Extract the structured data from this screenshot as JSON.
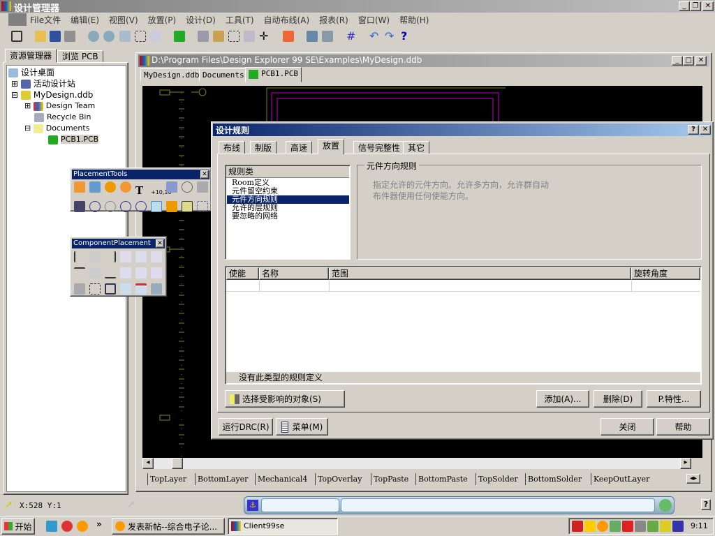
{
  "app": {
    "title": "设计管理器"
  },
  "menu": [
    "File文件",
    "编辑(E)",
    "视图(V)",
    "放置(P)",
    "设计(D)",
    "工具(T)",
    "自动布线(A)",
    "报表(R)",
    "窗口(W)",
    "帮助(H)"
  ],
  "left_tabs": [
    "资源管理器",
    "浏览 PCB"
  ],
  "tree": [
    {
      "label": "设计桌面",
      "icon": "desktop-icon"
    },
    {
      "label": "活动设计站",
      "icon": "workstation-icon"
    },
    {
      "label": "MyDesign.ddb",
      "icon": "database-icon"
    },
    {
      "label": "Design Team",
      "icon": "team-icon"
    },
    {
      "label": "Recycle Bin",
      "icon": "recycle-bin-icon"
    },
    {
      "label": "Documents",
      "icon": "folder-icon"
    },
    {
      "label": "PCB1.PCB",
      "icon": "pcb-file-icon"
    }
  ],
  "doc_window": {
    "title": "D:\\Program Files\\Design Explorer 99 SE\\Examples\\MyDesign.ddb",
    "tabs": [
      "MyDesign.ddb",
      "Documents",
      "PCB1.PCB"
    ]
  },
  "layers": [
    "TopLayer",
    "BottomLayer",
    "Mechanical4",
    "TopOverlay",
    "TopPaste",
    "BottomPaste",
    "TopSolder",
    "BottomSolder",
    "KeepOutLayer"
  ],
  "placement_tools": {
    "title": "PlacementTools"
  },
  "component_placement": {
    "title": "ComponentPlacement"
  },
  "dialog": {
    "title": "设计规则",
    "tabs": [
      "布线",
      "制版",
      "高速",
      "放置",
      "信号完整性",
      "其它"
    ],
    "active_tab": "放置",
    "rule_class_header": "规则类",
    "rule_classes": [
      "Room定义",
      "元件留空约束",
      "元件方向规则",
      "允许的层规则",
      "要忽略的网络"
    ],
    "selected_rule": "元件方向规则",
    "group_title": "元件方向规则",
    "description_line1": "指定允许的元件方向。允许多方向，允许群自动",
    "description_line2": "布件器使用任何使能方向。",
    "columns": [
      "使能",
      "名称",
      "范围",
      "旋转角度"
    ],
    "footer": "没有此类型的规则定义",
    "select_objects": "选择受影响的对象(S)",
    "add": "添加(A)...",
    "delete": "删除(D)",
    "properties": "P.特性...",
    "run_drc": "运行DRC(R)",
    "menu_btn": "菜单(M)",
    "close": "关闭",
    "help": "帮助"
  },
  "status": {
    "coords": "X:528 Y:1"
  },
  "taskbar": {
    "start": "开始",
    "items": [
      "发表新帖--综合电子论...",
      "Client99se"
    ],
    "clock": "9:11",
    "chevron": "»"
  },
  "colors": {
    "dialog_title": "#0a246a",
    "selection": "#0a246a",
    "canvas": "#000000",
    "pcb_outline": "#c000c0",
    "grid": "#808020"
  }
}
